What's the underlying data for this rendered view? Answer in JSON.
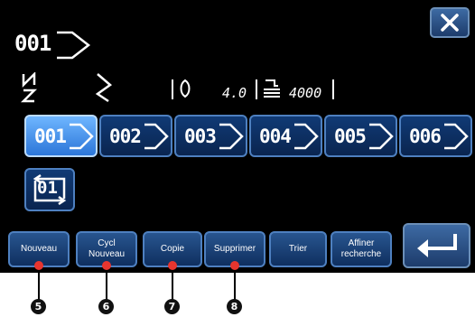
{
  "current_pattern": {
    "number": "001"
  },
  "status": {
    "tension": "4.0",
    "speed": "4000"
  },
  "patterns": [
    {
      "label": "001",
      "selected": true
    },
    {
      "label": "002",
      "selected": false
    },
    {
      "label": "003",
      "selected": false
    },
    {
      "label": "004",
      "selected": false
    },
    {
      "label": "005",
      "selected": false
    },
    {
      "label": "006",
      "selected": false
    }
  ],
  "cycle_pattern": {
    "label": "01"
  },
  "function_buttons": {
    "new": "Nouveau",
    "cycle_new": "Cycl\nNouveau",
    "copy": "Copie",
    "delete": "Supprimer",
    "sort": "Trier",
    "refine": "Affiner\nrecherche"
  },
  "callouts": [
    "5",
    "6",
    "7",
    "8"
  ],
  "colors": {
    "screen_bg": "#000000",
    "button_blue": "#0a2550",
    "selected_blue": "#2c76d8",
    "callout_red": "#e8352e"
  }
}
